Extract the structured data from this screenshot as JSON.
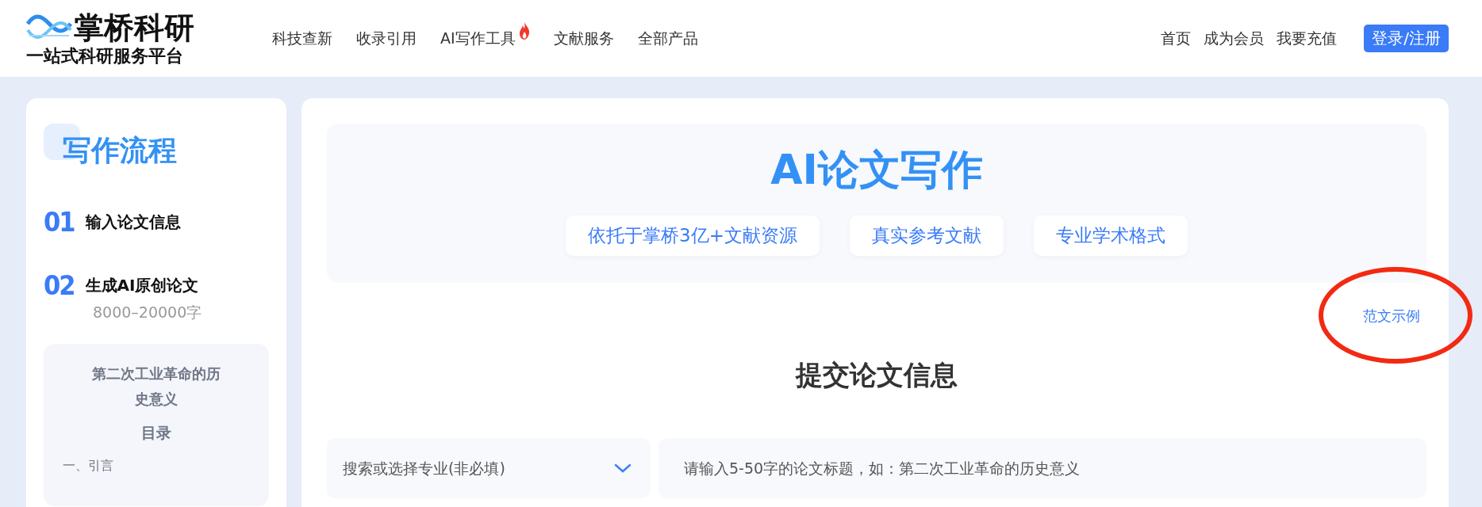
{
  "header": {
    "logo": {
      "title": "掌桥科研",
      "subtitle": "一站式科研服务平台"
    },
    "nav": [
      {
        "label": "科技查新",
        "hot": false
      },
      {
        "label": "收录引用",
        "hot": false
      },
      {
        "label": "AI写作工具",
        "hot": true
      },
      {
        "label": "文献服务",
        "hot": false
      },
      {
        "label": "全部产品",
        "hot": false
      }
    ],
    "links": [
      "首页",
      "成为会员",
      "我要充值"
    ],
    "login_button": "登录/注册"
  },
  "sidebar": {
    "title": "写作流程",
    "steps": [
      {
        "number": "01",
        "label": "输入论文信息"
      },
      {
        "number": "02",
        "label": "生成AI原创论文",
        "note": "8000–20000字"
      }
    ],
    "preview": {
      "title": "第二次工业革命的历史意义",
      "toc_heading": "目录",
      "items": [
        "一、引言"
      ]
    }
  },
  "main": {
    "banner": {
      "title": "AI论文写作",
      "tags": [
        "依托于掌桥3亿+文献资源",
        "真实参考文献",
        "专业学术格式"
      ]
    },
    "sample_link": "范文示例",
    "form_title": "提交论文信息",
    "major_select": {
      "placeholder": "搜索或选择专业(非必填)"
    },
    "title_input": {
      "placeholder": "请输入5-50字的论文标题，如：第二次工业革命的历史意义"
    }
  }
}
